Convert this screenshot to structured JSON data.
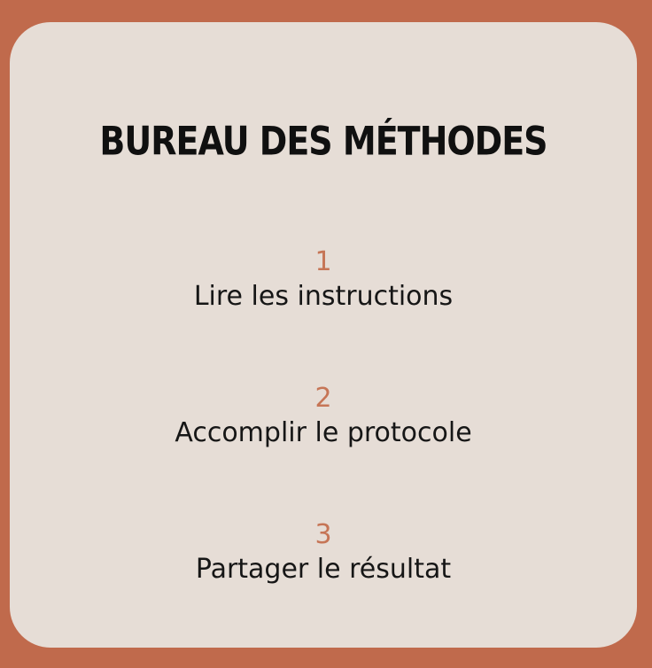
{
  "card": {
    "title": "BUREAU DES MÉTHODES",
    "steps": [
      {
        "number": "1",
        "label": "Lire les instructions"
      },
      {
        "number": "2",
        "label": "Accomplir le protocole"
      },
      {
        "number": "3",
        "label": "Partager le résultat"
      }
    ]
  },
  "colors": {
    "background": "#c06a4c",
    "card": "#e6ddd6",
    "accent": "#c67556",
    "text": "#161616"
  }
}
